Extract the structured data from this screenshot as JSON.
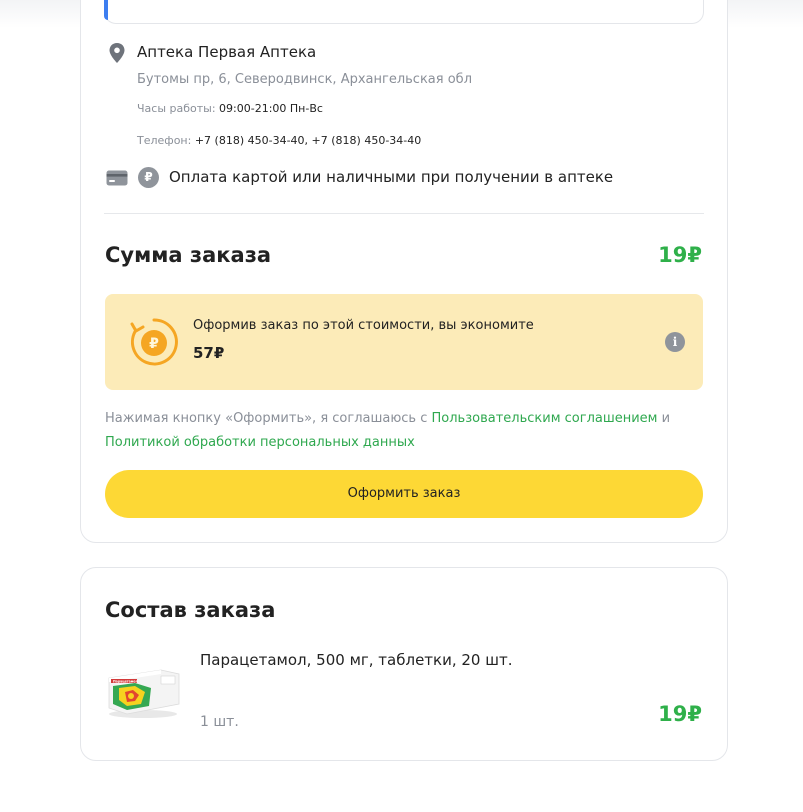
{
  "pharmacy": {
    "name": "Аптека Первая Аптека",
    "address": "Бутомы пр, 6, Северодвинск, Архангельская обл",
    "hours_label": "Часы работы:",
    "hours_value": "09:00-21:00 Пн-Вс",
    "phone_label": "Телефон:",
    "phone_value": "+7 (818) 450-34-40, +7 (818) 450-34-40",
    "payment_text": "Оплата картой или наличными при получении в аптеке",
    "ruble_symbol": "₽"
  },
  "summary": {
    "title": "Сумма заказа",
    "total": "19₽",
    "savings_text": "Оформив заказ по этой стоимости, вы экономите",
    "savings_amount": "57₽",
    "info_symbol": "i"
  },
  "consent": {
    "prefix": "Нажимая кнопку «Оформить», я соглашаюсь с ",
    "link_terms": "Пользовательским соглашением",
    "middle": " и ",
    "link_privacy": "Политикой обработки персональных данных"
  },
  "order_button": {
    "label": "Оформить заказ"
  },
  "composition": {
    "title": "Состав заказа",
    "items": [
      {
        "name": "Парацетамол, 500 мг, таблетки, 20 шт.",
        "quantity": "1 шт.",
        "price": "19₽",
        "package_text": "Парацетамол"
      }
    ]
  },
  "colors": {
    "accent_green": "#2fb04a",
    "button_yellow": "#fdd835",
    "savings_bg": "#fcebb8",
    "selection_blue": "#3d7ef0"
  },
  "icons": {
    "location": "map-pin-icon",
    "card": "credit-card-icon",
    "cash": "ruble-coin-icon",
    "savings": "ruble-cycle-icon",
    "info": "info-icon"
  }
}
